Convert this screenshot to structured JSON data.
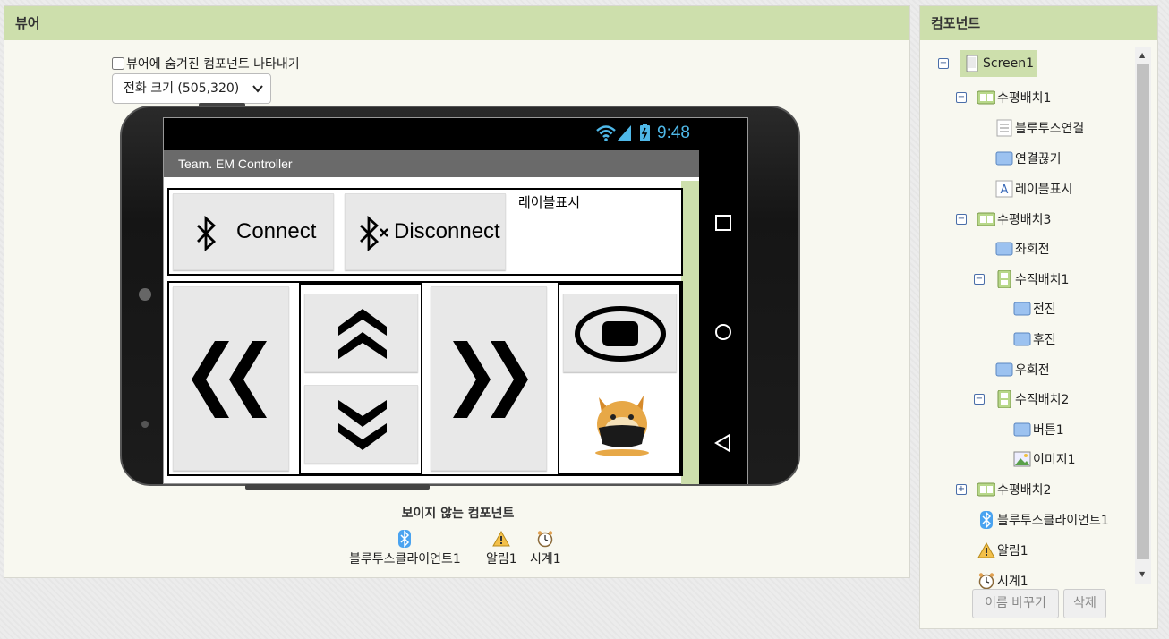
{
  "viewer": {
    "title": "뷰어",
    "show_hidden_label": "뷰어에 숨겨진 컴포넌트 나타내기",
    "phone_size": "전화 크기 (505,320)",
    "invisible_title": "보이지 않는 컴포넌트",
    "invisible_items": [
      "블루투스클라이언트1",
      "알림1",
      "시계1"
    ]
  },
  "phone": {
    "time": "9:48",
    "app_title": "Team. EM Controller",
    "connect_label": "Connect",
    "disconnect_label": "Disconnect",
    "label_text": "레이블표시"
  },
  "components": {
    "title": "컴포넌트",
    "tree": [
      {
        "label": "Screen1",
        "toggle": "minus",
        "icon": "screen-icon"
      },
      {
        "label": "수평배치1",
        "toggle": "minus",
        "icon": "horizontal-arrangement-icon"
      },
      {
        "label": "블루투스연결",
        "icon": "listpicker-icon"
      },
      {
        "label": "연결끊기",
        "icon": "button-icon"
      },
      {
        "label": "레이블표시",
        "icon": "label-icon"
      },
      {
        "label": "수평배치3",
        "toggle": "minus",
        "icon": "horizontal-arrangement-icon"
      },
      {
        "label": "좌회전",
        "icon": "button-icon"
      },
      {
        "label": "수직배치1",
        "toggle": "minus",
        "icon": "vertical-arrangement-icon"
      },
      {
        "label": "전진",
        "icon": "button-icon"
      },
      {
        "label": "후진",
        "icon": "button-icon"
      },
      {
        "label": "우회전",
        "icon": "button-icon"
      },
      {
        "label": "수직배치2",
        "toggle": "minus",
        "icon": "vertical-arrangement-icon"
      },
      {
        "label": "버튼1",
        "icon": "button-icon"
      },
      {
        "label": "이미지1",
        "icon": "image-icon"
      },
      {
        "label": "수평배치2",
        "toggle": "plus",
        "icon": "horizontal-arrangement-icon"
      },
      {
        "label": "블루투스클라이언트1",
        "icon": "bluetooth-icon"
      },
      {
        "label": "알림1",
        "icon": "notifier-icon"
      },
      {
        "label": "시계1",
        "icon": "clock-icon"
      }
    ],
    "rename_button": "이름 바꾸기",
    "delete_button": "삭제"
  },
  "colors": {
    "header": "#cddfac",
    "accent": "#4fb8e8"
  }
}
